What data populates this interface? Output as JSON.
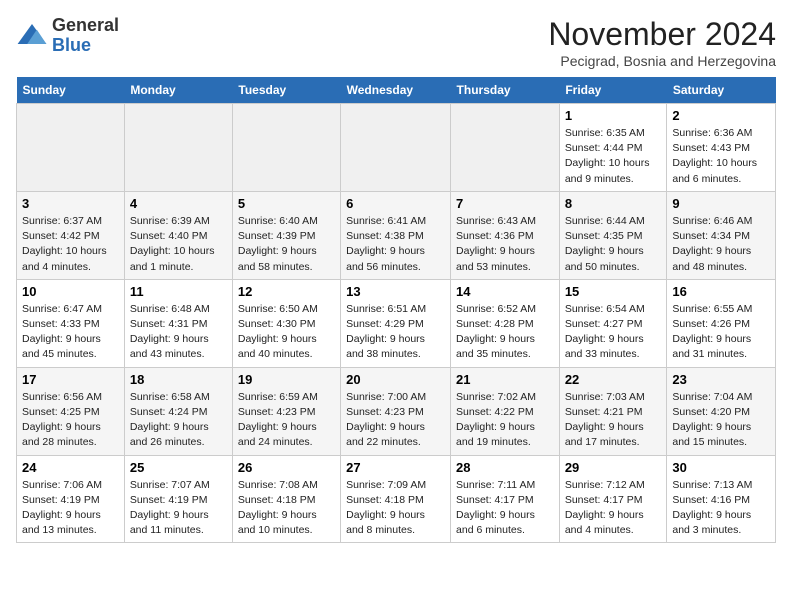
{
  "logo": {
    "general": "General",
    "blue": "Blue"
  },
  "title": "November 2024",
  "subtitle": "Pecigrad, Bosnia and Herzegovina",
  "days_of_week": [
    "Sunday",
    "Monday",
    "Tuesday",
    "Wednesday",
    "Thursday",
    "Friday",
    "Saturday"
  ],
  "weeks": [
    [
      {
        "day": "",
        "info": ""
      },
      {
        "day": "",
        "info": ""
      },
      {
        "day": "",
        "info": ""
      },
      {
        "day": "",
        "info": ""
      },
      {
        "day": "",
        "info": ""
      },
      {
        "day": "1",
        "info": "Sunrise: 6:35 AM\nSunset: 4:44 PM\nDaylight: 10 hours and 9 minutes."
      },
      {
        "day": "2",
        "info": "Sunrise: 6:36 AM\nSunset: 4:43 PM\nDaylight: 10 hours and 6 minutes."
      }
    ],
    [
      {
        "day": "3",
        "info": "Sunrise: 6:37 AM\nSunset: 4:42 PM\nDaylight: 10 hours and 4 minutes."
      },
      {
        "day": "4",
        "info": "Sunrise: 6:39 AM\nSunset: 4:40 PM\nDaylight: 10 hours and 1 minute."
      },
      {
        "day": "5",
        "info": "Sunrise: 6:40 AM\nSunset: 4:39 PM\nDaylight: 9 hours and 58 minutes."
      },
      {
        "day": "6",
        "info": "Sunrise: 6:41 AM\nSunset: 4:38 PM\nDaylight: 9 hours and 56 minutes."
      },
      {
        "day": "7",
        "info": "Sunrise: 6:43 AM\nSunset: 4:36 PM\nDaylight: 9 hours and 53 minutes."
      },
      {
        "day": "8",
        "info": "Sunrise: 6:44 AM\nSunset: 4:35 PM\nDaylight: 9 hours and 50 minutes."
      },
      {
        "day": "9",
        "info": "Sunrise: 6:46 AM\nSunset: 4:34 PM\nDaylight: 9 hours and 48 minutes."
      }
    ],
    [
      {
        "day": "10",
        "info": "Sunrise: 6:47 AM\nSunset: 4:33 PM\nDaylight: 9 hours and 45 minutes."
      },
      {
        "day": "11",
        "info": "Sunrise: 6:48 AM\nSunset: 4:31 PM\nDaylight: 9 hours and 43 minutes."
      },
      {
        "day": "12",
        "info": "Sunrise: 6:50 AM\nSunset: 4:30 PM\nDaylight: 9 hours and 40 minutes."
      },
      {
        "day": "13",
        "info": "Sunrise: 6:51 AM\nSunset: 4:29 PM\nDaylight: 9 hours and 38 minutes."
      },
      {
        "day": "14",
        "info": "Sunrise: 6:52 AM\nSunset: 4:28 PM\nDaylight: 9 hours and 35 minutes."
      },
      {
        "day": "15",
        "info": "Sunrise: 6:54 AM\nSunset: 4:27 PM\nDaylight: 9 hours and 33 minutes."
      },
      {
        "day": "16",
        "info": "Sunrise: 6:55 AM\nSunset: 4:26 PM\nDaylight: 9 hours and 31 minutes."
      }
    ],
    [
      {
        "day": "17",
        "info": "Sunrise: 6:56 AM\nSunset: 4:25 PM\nDaylight: 9 hours and 28 minutes."
      },
      {
        "day": "18",
        "info": "Sunrise: 6:58 AM\nSunset: 4:24 PM\nDaylight: 9 hours and 26 minutes."
      },
      {
        "day": "19",
        "info": "Sunrise: 6:59 AM\nSunset: 4:23 PM\nDaylight: 9 hours and 24 minutes."
      },
      {
        "day": "20",
        "info": "Sunrise: 7:00 AM\nSunset: 4:23 PM\nDaylight: 9 hours and 22 minutes."
      },
      {
        "day": "21",
        "info": "Sunrise: 7:02 AM\nSunset: 4:22 PM\nDaylight: 9 hours and 19 minutes."
      },
      {
        "day": "22",
        "info": "Sunrise: 7:03 AM\nSunset: 4:21 PM\nDaylight: 9 hours and 17 minutes."
      },
      {
        "day": "23",
        "info": "Sunrise: 7:04 AM\nSunset: 4:20 PM\nDaylight: 9 hours and 15 minutes."
      }
    ],
    [
      {
        "day": "24",
        "info": "Sunrise: 7:06 AM\nSunset: 4:19 PM\nDaylight: 9 hours and 13 minutes."
      },
      {
        "day": "25",
        "info": "Sunrise: 7:07 AM\nSunset: 4:19 PM\nDaylight: 9 hours and 11 minutes."
      },
      {
        "day": "26",
        "info": "Sunrise: 7:08 AM\nSunset: 4:18 PM\nDaylight: 9 hours and 10 minutes."
      },
      {
        "day": "27",
        "info": "Sunrise: 7:09 AM\nSunset: 4:18 PM\nDaylight: 9 hours and 8 minutes."
      },
      {
        "day": "28",
        "info": "Sunrise: 7:11 AM\nSunset: 4:17 PM\nDaylight: 9 hours and 6 minutes."
      },
      {
        "day": "29",
        "info": "Sunrise: 7:12 AM\nSunset: 4:17 PM\nDaylight: 9 hours and 4 minutes."
      },
      {
        "day": "30",
        "info": "Sunrise: 7:13 AM\nSunset: 4:16 PM\nDaylight: 9 hours and 3 minutes."
      }
    ]
  ]
}
